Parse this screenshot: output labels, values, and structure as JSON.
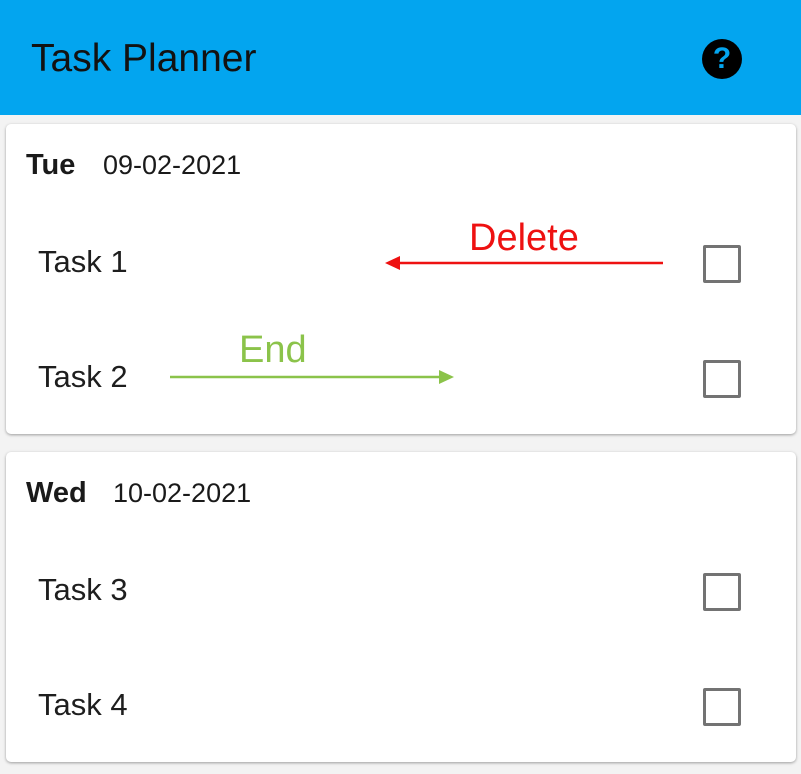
{
  "app": {
    "title": "Task Planner",
    "help_glyph": "?",
    "accent_color": "#03a5ef"
  },
  "days": [
    {
      "day": "Tue",
      "date": "09-02-2021",
      "tasks": [
        {
          "label": "Task 1",
          "checked": false
        },
        {
          "label": "Task 2",
          "checked": false
        }
      ]
    },
    {
      "day": "Wed",
      "date": "10-02-2021",
      "tasks": [
        {
          "label": "Task 3",
          "checked": false
        },
        {
          "label": "Task 4",
          "checked": false
        }
      ]
    }
  ],
  "annotations": {
    "delete": {
      "label": "Delete",
      "color": "#ee1111",
      "direction": "left"
    },
    "end": {
      "label": "End",
      "color": "#8bc34a",
      "direction": "right"
    }
  },
  "icons": {
    "help": "help-circle-icon"
  }
}
